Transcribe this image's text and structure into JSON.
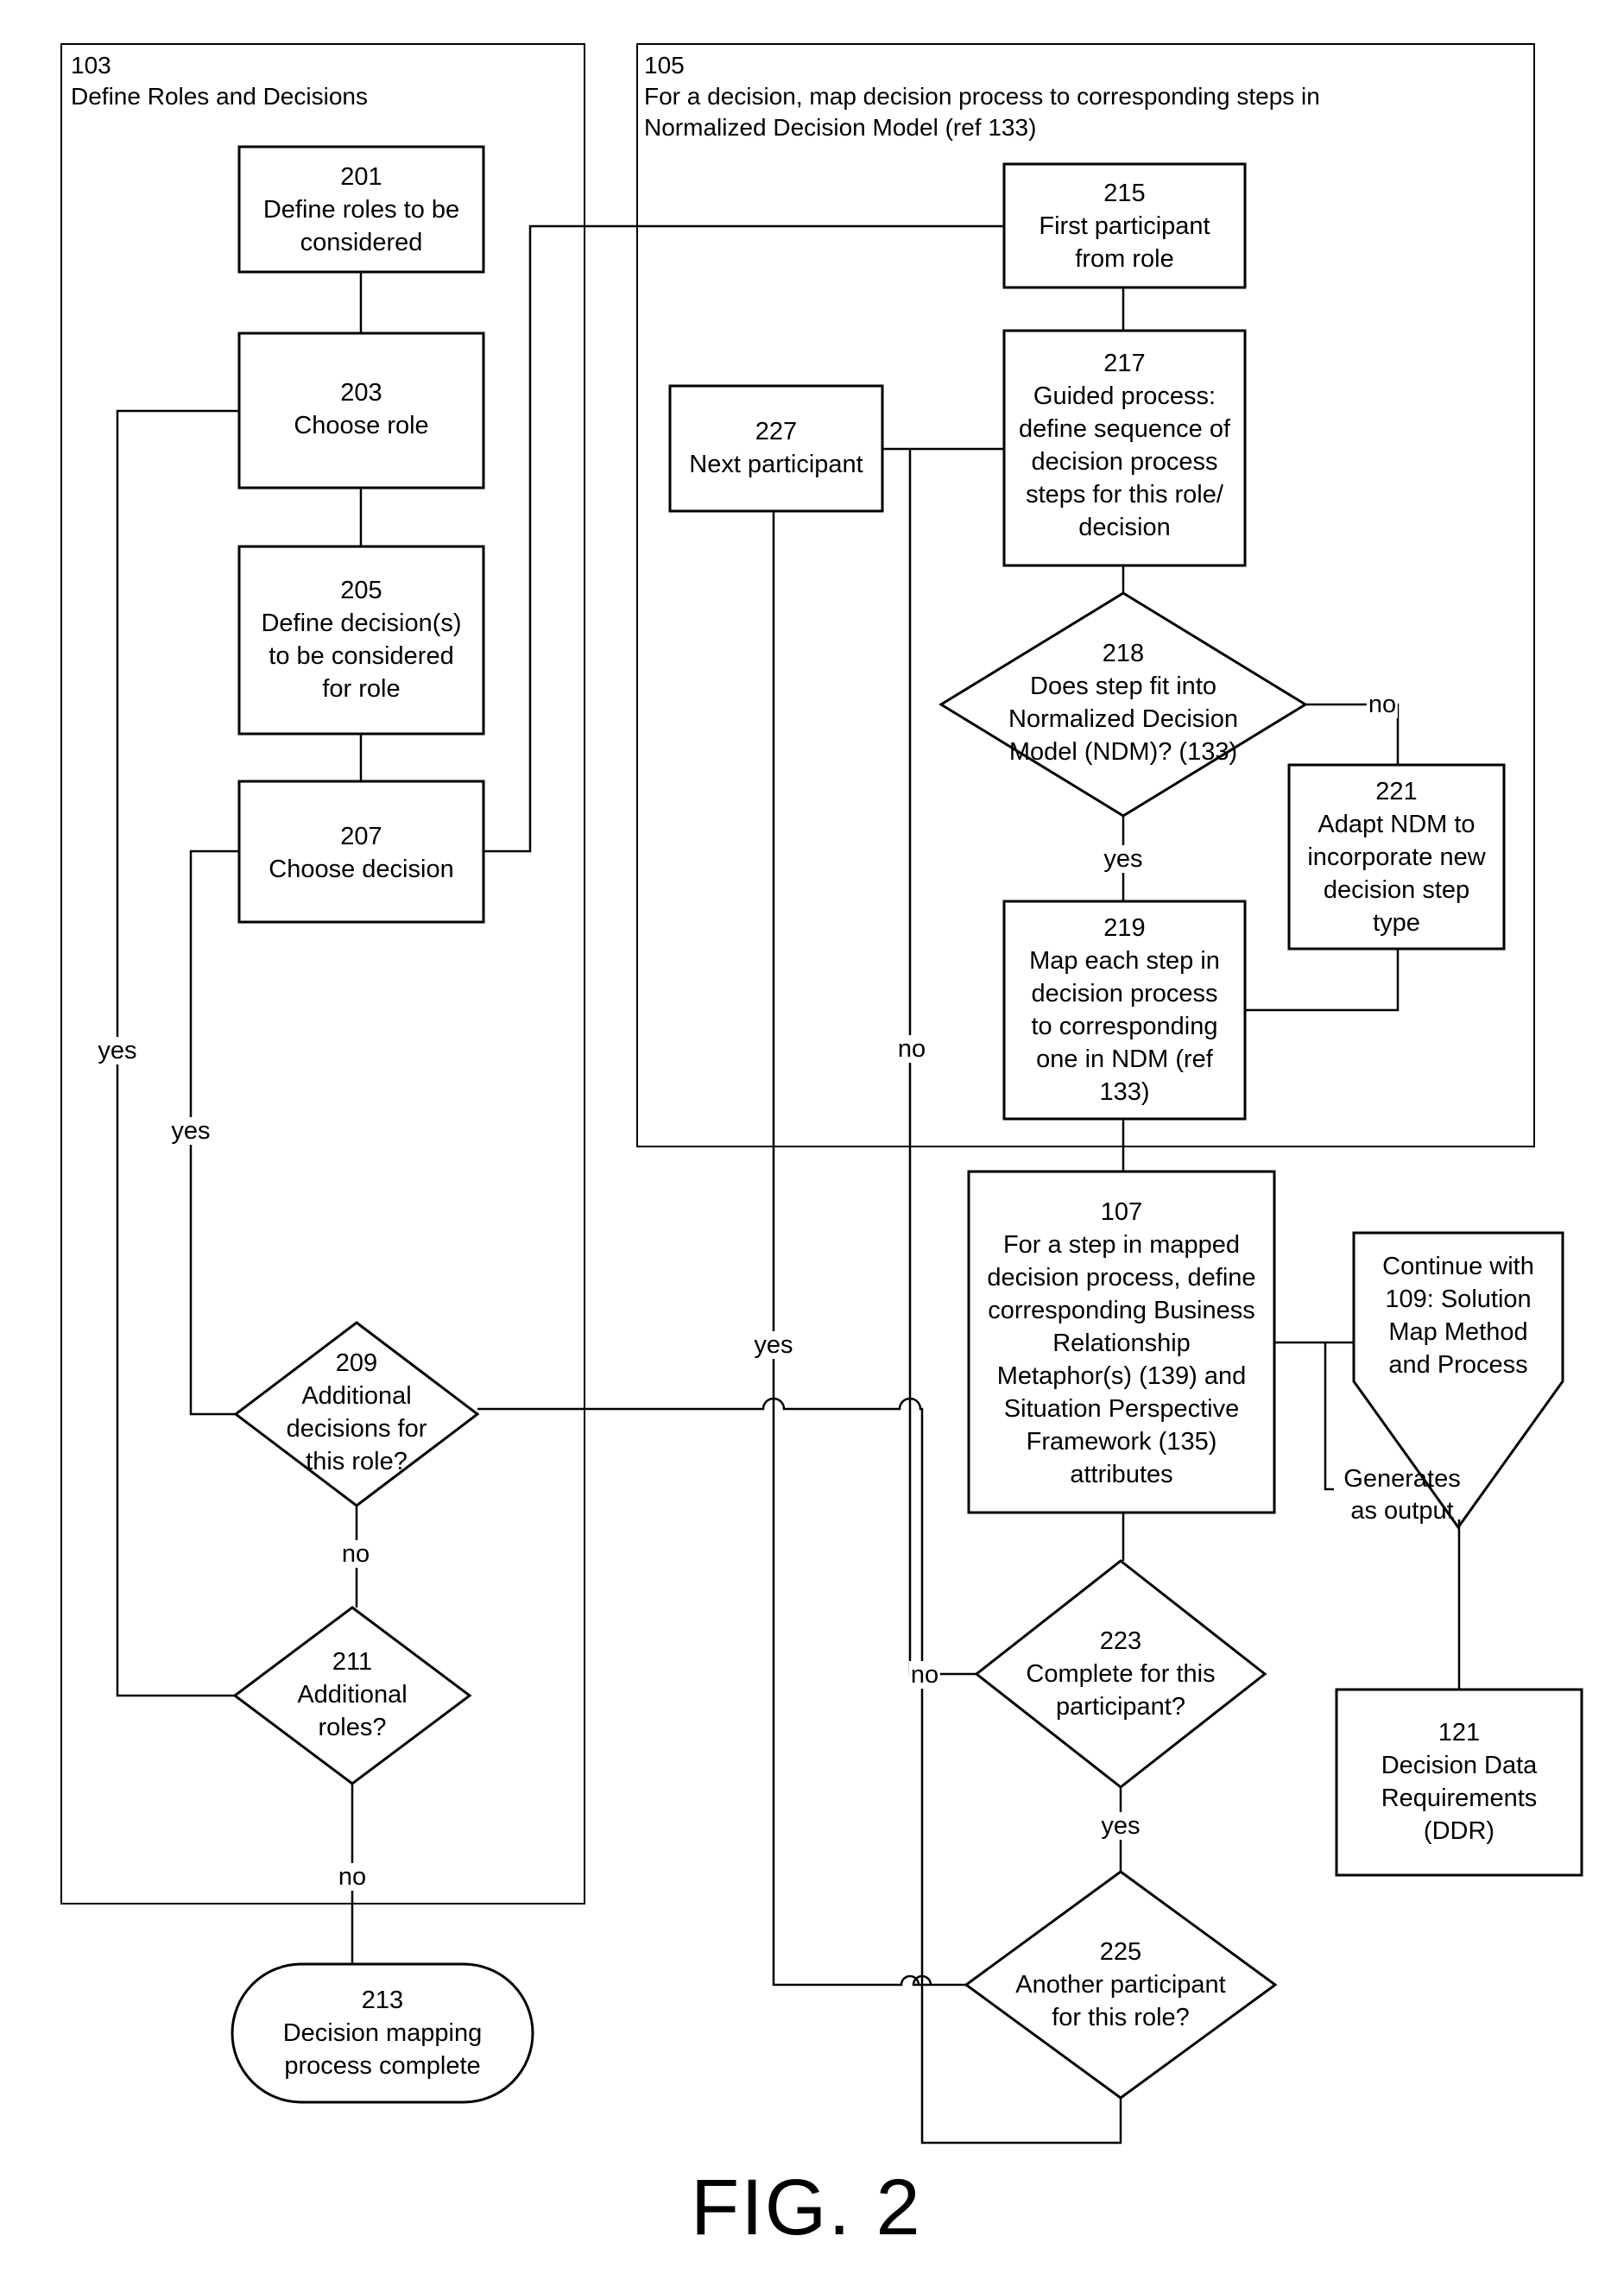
{
  "groups": {
    "g103": {
      "label": "103\nDefine Roles and Decisions"
    },
    "g105": {
      "label": "105\nFor a decision, map decision process to corresponding steps in\nNormalized Decision Model (ref 133)"
    }
  },
  "nodes": {
    "n201": {
      "shape": "process",
      "text": "201\nDefine roles to be\nconsidered"
    },
    "n203": {
      "shape": "process",
      "text": "203\nChoose role"
    },
    "n205": {
      "shape": "process",
      "text": "205\nDefine decision(s)\nto be considered\nfor role"
    },
    "n207": {
      "shape": "process",
      "text": "207\nChoose decision"
    },
    "n209": {
      "shape": "decision",
      "text": "209\nAdditional\ndecisions for\nthis role?"
    },
    "n211": {
      "shape": "decision",
      "text": "211\nAdditional\nroles?"
    },
    "n213": {
      "shape": "terminator",
      "text": "213\nDecision mapping\nprocess complete"
    },
    "n215": {
      "shape": "process",
      "text": "215\nFirst participant\nfrom role"
    },
    "n217": {
      "shape": "process",
      "text": "217\nGuided process:\ndefine sequence of\ndecision process\nsteps for this role/\ndecision"
    },
    "n227": {
      "shape": "process",
      "text": "227\nNext participant"
    },
    "n218": {
      "shape": "decision",
      "text": "218\nDoes step fit into\nNormalized Decision\nModel (NDM)? (133)"
    },
    "n221": {
      "shape": "process",
      "text": "221\nAdapt NDM to\nincorporate new\ndecision step\ntype"
    },
    "n219": {
      "shape": "process",
      "text": "219\nMap each step in\ndecision process\nto corresponding\none in NDM (ref\n133)"
    },
    "n107": {
      "shape": "process",
      "text": "107\nFor a step in mapped\ndecision process, define\ncorresponding Business\nRelationship\nMetaphor(s) (139) and\nSituation Perspective\nFramework (135)\nattributes"
    },
    "n109": {
      "shape": "off-page-connector",
      "text": "Continue with\n109: Solution\nMap Method\nand Process"
    },
    "n121": {
      "shape": "process",
      "text": "121\nDecision Data\nRequirements\n(DDR)"
    },
    "n223": {
      "shape": "decision",
      "text": "223\nComplete for this\nparticipant?"
    },
    "n225": {
      "shape": "decision",
      "text": "225\nAnother participant\nfor this role?"
    }
  },
  "edge_labels": {
    "e203_yes": "yes",
    "e207_yes": "yes",
    "e209_no": "no",
    "e211_no": "no",
    "e218_no": "no",
    "e218_yes": "yes",
    "e223_no": "no",
    "e223_yes": "yes",
    "e225_yes": "yes",
    "e225_no": "no",
    "e107_output": "Generates\nas output"
  },
  "caption": "FIG. 2"
}
